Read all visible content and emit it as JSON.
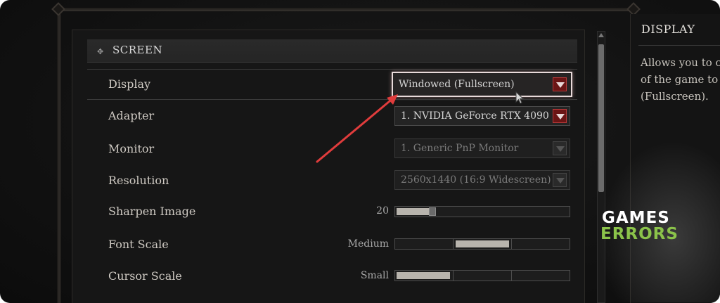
{
  "section": {
    "title": "SCREEN"
  },
  "rows": {
    "display": {
      "label": "Display",
      "value": "Windowed (Fullscreen)"
    },
    "adapter": {
      "label": "Adapter",
      "value": "1. NVIDIA GeForce RTX 4090"
    },
    "monitor": {
      "label": "Monitor",
      "value": "1. Generic PnP Monitor"
    },
    "resolution": {
      "label": "Resolution",
      "value": "2560x1440 (16:9 Widescreen)"
    },
    "sharpen": {
      "label": "Sharpen Image",
      "value": "20"
    },
    "font_scale": {
      "label": "Font Scale",
      "value": "Medium"
    },
    "cursor_scale": {
      "label": "Cursor Scale",
      "value": "Small"
    }
  },
  "info_panel": {
    "title": "DISPLAY",
    "lines": [
      "Allows you to c",
      "of the game to",
      "(Fullscreen)."
    ]
  },
  "watermark": {
    "top": "GAMES",
    "bottom": "ERRORS"
  },
  "colors": {
    "accent_red": "#6a1515",
    "annotation_arrow": "#e03c3c",
    "watermark_green": "#8bc34a"
  }
}
